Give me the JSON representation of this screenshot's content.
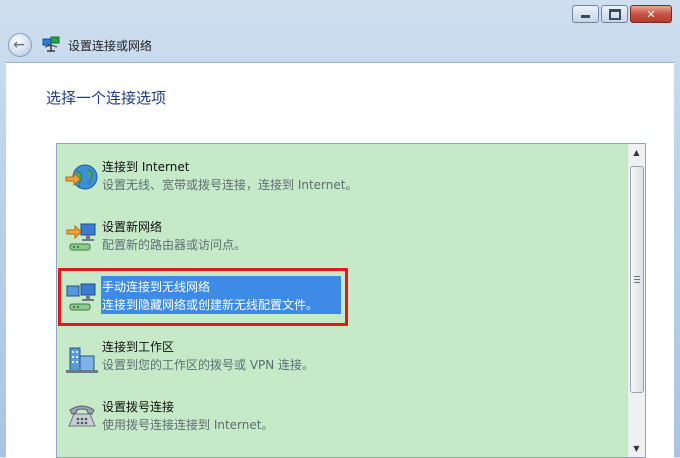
{
  "window": {
    "title": "设置连接或网络",
    "caption": {
      "minimize": "minimize",
      "maximize": "maximize",
      "close": "✕"
    }
  },
  "heading": "选择一个连接选项",
  "options": [
    {
      "title": "连接到 Internet",
      "desc": "设置无线、宽带或拨号连接，连接到 Internet。",
      "icon": "globe-connect-icon",
      "selected": false
    },
    {
      "title": "设置新网络",
      "desc": "配置新的路由器或访问点。",
      "icon": "network-setup-icon",
      "selected": false
    },
    {
      "title": "手动连接到无线网络",
      "desc": "连接到隐藏网络或创建新无线配置文件。",
      "icon": "wireless-network-icon",
      "selected": true
    },
    {
      "title": "连接到工作区",
      "desc": "设置到您的工作区的拨号或 VPN 连接。",
      "icon": "workplace-icon",
      "selected": false
    },
    {
      "title": "设置拨号连接",
      "desc": "使用拨号连接连接到 Internet。",
      "icon": "phone-icon",
      "selected": false
    }
  ],
  "colors": {
    "list_bg": "#c6e9c8",
    "selection": "#3d8be6",
    "highlight_border": "#e21919",
    "heading": "#1f3d8c"
  }
}
